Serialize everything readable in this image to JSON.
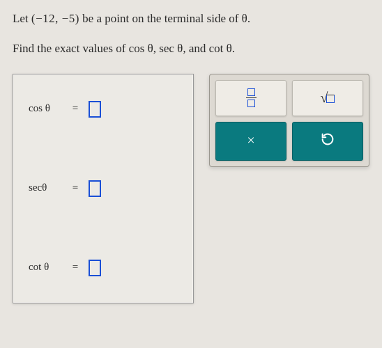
{
  "problem": {
    "line1_prefix": "Let ",
    "point": "(−12, −5)",
    "line1_suffix": " be a point on the terminal side of ",
    "theta": "θ",
    "period": ".",
    "line2": "Find the exact values of ",
    "func1": "cos θ",
    "func2": "sec θ",
    "func3": "cot θ",
    "comma": ", ",
    "and": ", and "
  },
  "answers": {
    "rows": [
      {
        "label": "cos θ",
        "equals": "="
      },
      {
        "label": "secθ",
        "equals": "="
      },
      {
        "label": "cot θ",
        "equals": "="
      }
    ]
  },
  "tools": {
    "fraction": "fraction",
    "sqrt": "square-root",
    "times": "×",
    "undo": "undo"
  }
}
